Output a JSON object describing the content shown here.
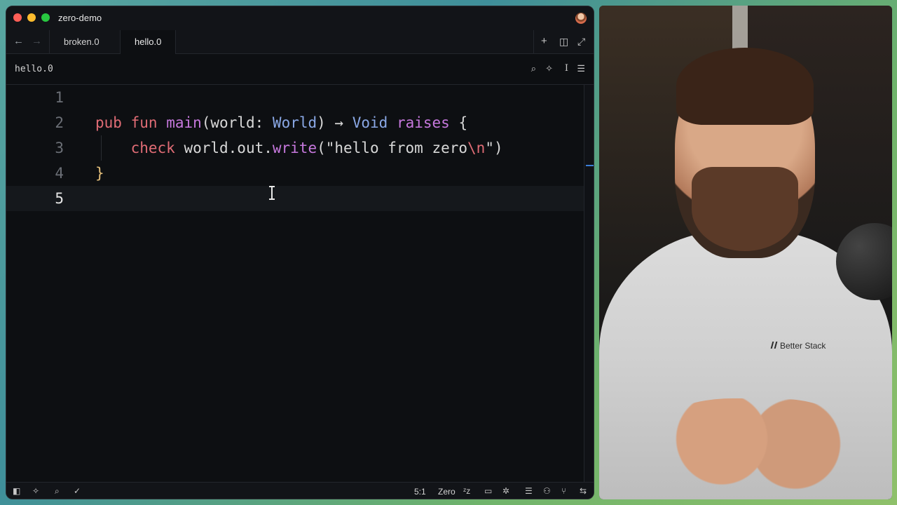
{
  "window": {
    "title": "zero-demo",
    "tabs": [
      {
        "label": "broken.0",
        "active": false
      },
      {
        "label": "hello.0",
        "active": true
      }
    ],
    "breadcrumb": "hello.0"
  },
  "editor": {
    "lines": [
      {
        "number": "1",
        "tokens": []
      },
      {
        "number": "2",
        "tokens": [
          {
            "text": "pub",
            "cls": "kw"
          },
          {
            "text": " ",
            "cls": ""
          },
          {
            "text": "fun",
            "cls": "kw"
          },
          {
            "text": " ",
            "cls": ""
          },
          {
            "text": "main",
            "cls": "fn"
          },
          {
            "text": "(world: ",
            "cls": ""
          },
          {
            "text": "World",
            "cls": "ty"
          },
          {
            "text": ") → ",
            "cls": ""
          },
          {
            "text": "Void",
            "cls": "ty"
          },
          {
            "text": " ",
            "cls": ""
          },
          {
            "text": "raises",
            "cls": "fn"
          },
          {
            "text": " {",
            "cls": ""
          }
        ]
      },
      {
        "number": "3",
        "tokens": [
          {
            "text": "    ",
            "cls": ""
          },
          {
            "text": "check",
            "cls": "kw"
          },
          {
            "text": " world.out.",
            "cls": ""
          },
          {
            "text": "write",
            "cls": "fn"
          },
          {
            "text": "(\"hello from zero",
            "cls": "str"
          },
          {
            "text": "\\n",
            "cls": "esc"
          },
          {
            "text": "\")",
            "cls": "str"
          }
        ]
      },
      {
        "number": "4",
        "tokens": [
          {
            "text": "}",
            "cls": "brace"
          }
        ]
      },
      {
        "number": "5",
        "tokens": [],
        "active": true
      }
    ]
  },
  "statusbar": {
    "cursor_position": "5:1",
    "language": "Zero"
  },
  "icons": {
    "tab_actions": [
      "plus-icon",
      "split-pane-icon",
      "expand-icon"
    ],
    "breadcrumb_actions": [
      "search-icon",
      "assistant-icon",
      "text-cursor-icon",
      "settings-icon"
    ],
    "status_left": [
      "sidebar-toggle-icon",
      "assistant-icon",
      "search-icon",
      "check-icon"
    ],
    "status_right": [
      "sleep-icon",
      "terminal-icon",
      "debug-icon",
      "outline-icon",
      "collaborators-icon",
      "git-branch-icon",
      "panel-toggle-icon"
    ]
  },
  "video_overlay": {
    "shirt_logo": "Better Stack"
  }
}
